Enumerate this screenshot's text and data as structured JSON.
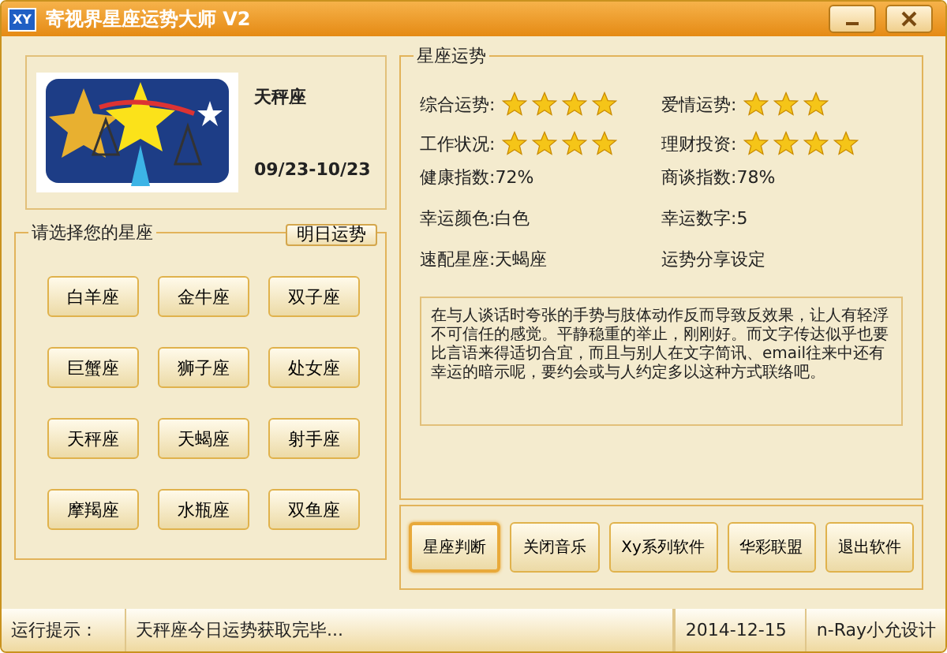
{
  "window": {
    "title": "寄视界星座运势大师 V2",
    "app_icon": "XY"
  },
  "sign_card": {
    "name": "天秤座",
    "dates": "09/23-10/23"
  },
  "sign_picker": {
    "title": "请选择您的星座",
    "tomorrow_button": "明日运势",
    "signs": [
      {
        "label": "白羊座",
        "selected": false
      },
      {
        "label": "金牛座",
        "selected": false
      },
      {
        "label": "双子座",
        "selected": false
      },
      {
        "label": "巨蟹座",
        "selected": false
      },
      {
        "label": "狮子座",
        "selected": false
      },
      {
        "label": "处女座",
        "selected": false
      },
      {
        "label": "天秤座",
        "selected": false
      },
      {
        "label": "天蝎座",
        "selected": false
      },
      {
        "label": "射手座",
        "selected": false
      },
      {
        "label": "摩羯座",
        "selected": false
      },
      {
        "label": "水瓶座",
        "selected": false
      },
      {
        "label": "双鱼座",
        "selected": false
      }
    ]
  },
  "fortune": {
    "title": "星座运势",
    "ratings": [
      {
        "label": "综合运势:",
        "stars": 4
      },
      {
        "label": "爱情运势:",
        "stars": 3
      },
      {
        "label": "工作状况:",
        "stars": 4
      },
      {
        "label": "理财投资:",
        "stars": 4
      }
    ],
    "facts": [
      "健康指数:72%",
      "商谈指数:78%",
      "幸运颜色:白色",
      "幸运数字:5",
      "速配星座:天蝎座",
      "运势分享设定"
    ],
    "description": "在与人谈话时夸张的手势与肢体动作反而导致反效果，让人有轻浮不可信任的感觉。平静稳重的举止，刚刚好。而文字传达似乎也要比言语来得适切合宜，而且与别人在文字简讯、email往来中还有幸运的暗示呢，要约会或与人约定多以这种方式联络吧。"
  },
  "actions": [
    {
      "label": "星座判断",
      "selected": true
    },
    {
      "label": "关闭音乐",
      "selected": false
    },
    {
      "label": "Xy系列软件",
      "selected": false
    },
    {
      "label": "华彩联盟",
      "selected": false
    },
    {
      "label": "退出软件",
      "selected": false
    }
  ],
  "status_bar": {
    "label": "运行提示：",
    "message": "天秤座今日运势获取完毕...",
    "date": "2014-12-15",
    "credit": "n-Ray小允设计"
  }
}
